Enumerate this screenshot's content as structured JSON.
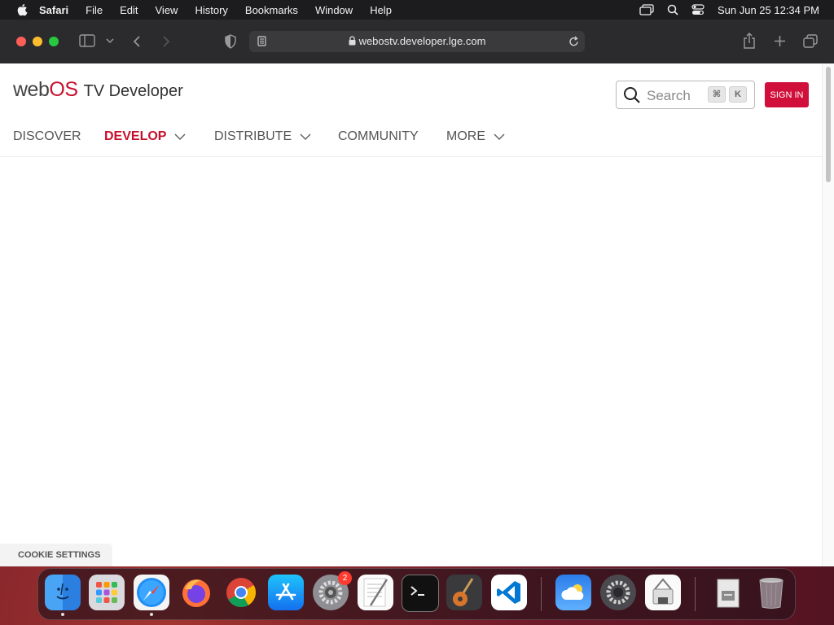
{
  "menubar": {
    "app_name": "Safari",
    "items": [
      "File",
      "Edit",
      "View",
      "History",
      "Bookmarks",
      "Window",
      "Help"
    ],
    "clock": "Sun Jun 25  12:34 PM"
  },
  "browser": {
    "url": "webostv.developer.lge.com"
  },
  "site": {
    "logo_web": "web",
    "logo_os": "OS",
    "logo_suffix": "TV Developer",
    "search_placeholder": "Search",
    "shortcut_cmd": "⌘",
    "shortcut_key": "K",
    "signin_label": "SIGN IN",
    "nav": [
      {
        "label": "DISCOVER"
      },
      {
        "label": "DEVELOP"
      },
      {
        "label": "DISTRIBUTE"
      },
      {
        "label": "COMMUNITY"
      },
      {
        "label": "MORE"
      }
    ],
    "cookie_label": "COOKIE SETTINGS"
  },
  "dock": {
    "apps": [
      "Finder",
      "Launchpad",
      "Safari",
      "Firefox",
      "Chrome",
      "App Store",
      "System Preferences",
      "TextEdit",
      "Terminal",
      "GarageBand",
      "Visual Studio Code",
      "Weather",
      "System Settings",
      "Archive Utility",
      "Downloads",
      "Trash"
    ],
    "system_prefs_badge": "2"
  },
  "colors": {
    "brand_red": "#c8102e",
    "signin_bg": "#d0103a"
  }
}
